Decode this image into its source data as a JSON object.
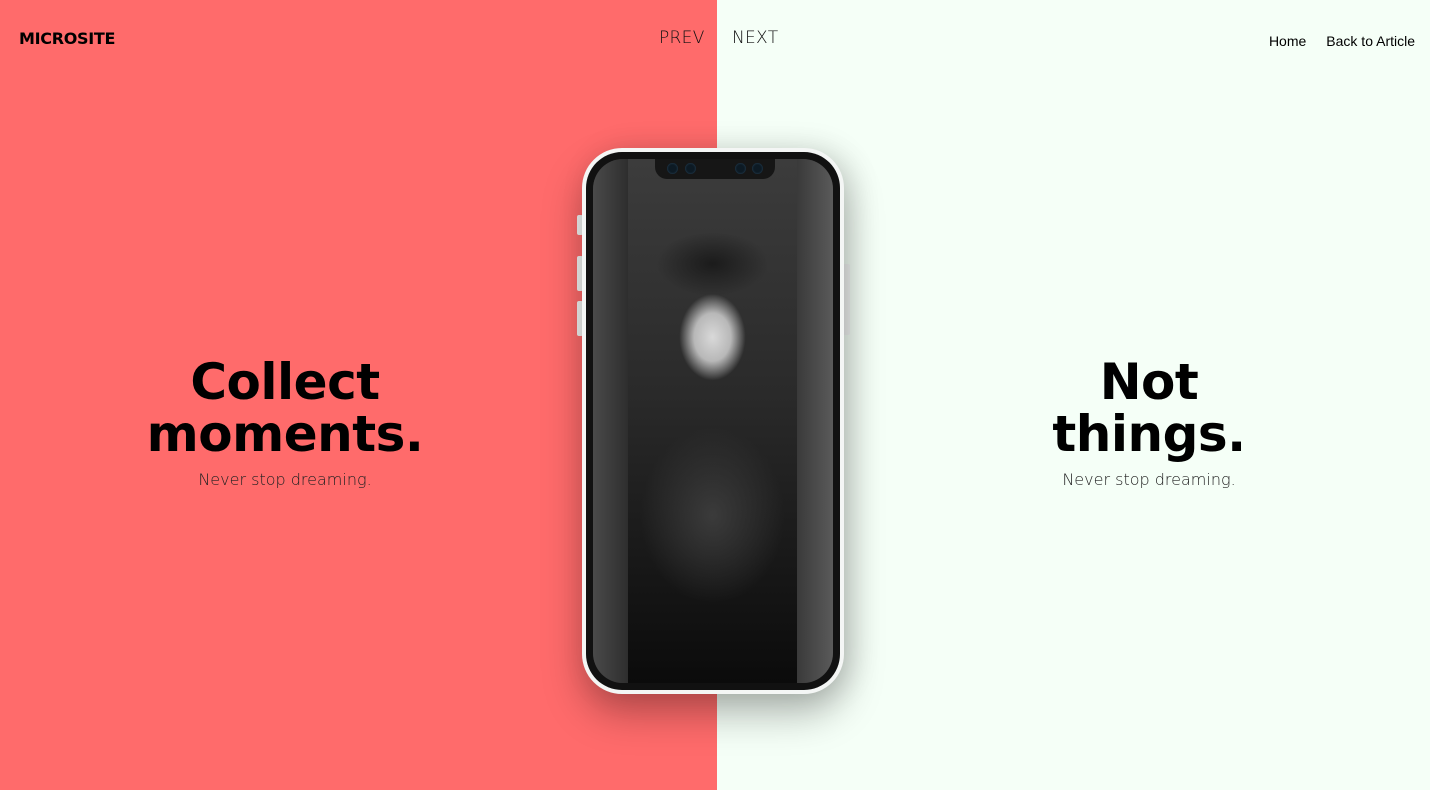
{
  "header": {
    "logo": "MICROSITE",
    "prev_label": "PREV",
    "next_label": "NEXT",
    "nav": [
      {
        "label": "Home"
      },
      {
        "label": "Back to Article"
      }
    ]
  },
  "left_panel": {
    "title_line1": "Collect",
    "title_line2": "moments.",
    "subtitle": "Never stop dreaming.",
    "background": "#ff6b6b"
  },
  "right_panel": {
    "title_line1": "Not",
    "title_line2": "things.",
    "subtitle": "Never stop dreaming.",
    "background": "#f5fff7"
  },
  "phone": {
    "screen": "black-and-white portrait photo"
  }
}
